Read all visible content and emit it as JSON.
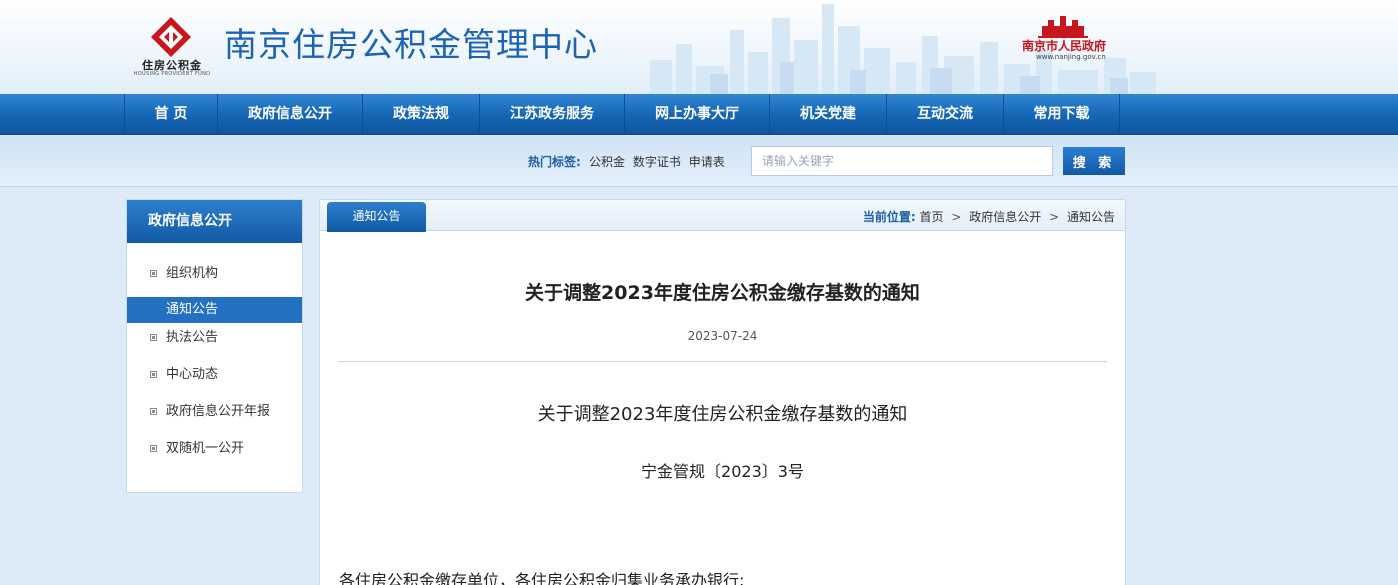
{
  "header": {
    "logo_text": "住房公积金",
    "logo_subtext": "HOUSING PROVIDENT FUND",
    "site_title": "南京住房公积金管理中心",
    "gov_name": "南京市人民政府",
    "gov_url": "www.nanjing.gov.cn"
  },
  "nav": {
    "items": [
      {
        "label": "首 页"
      },
      {
        "label": "政府信息公开"
      },
      {
        "label": "政策法规"
      },
      {
        "label": "江苏政务服务"
      },
      {
        "label": "网上办事大厅"
      },
      {
        "label": "机关党建"
      },
      {
        "label": "互动交流"
      },
      {
        "label": "常用下载"
      }
    ]
  },
  "search": {
    "hot_label": "热门标签:",
    "tags": [
      "公积金",
      "数字证书",
      "申请表"
    ],
    "placeholder": "请输入关键字",
    "button_label": "搜 索"
  },
  "sidebar": {
    "title": "政府信息公开",
    "items": [
      {
        "label": "组织机构",
        "active": false
      },
      {
        "label": "通知公告",
        "active": true
      },
      {
        "label": "执法公告",
        "active": false
      },
      {
        "label": "中心动态",
        "active": false
      },
      {
        "label": "政府信息公开年报",
        "active": false
      },
      {
        "label": "双随机一公开",
        "active": false
      }
    ]
  },
  "panel": {
    "tab_label": "通知公告",
    "breadcrumb": {
      "label": "当前位置:",
      "items": [
        "首页",
        "政府信息公开",
        "通知公告"
      ],
      "separator": ">"
    }
  },
  "article": {
    "title": "关于调整2023年度住房公积金缴存基数的通知",
    "date": "2023-07-24",
    "doc_title": "关于调整2023年度住房公积金缴存基数的通知",
    "doc_number": "宁金管规〔2023〕3号",
    "greeting": "各住房公积金缴存单位，各住房公积金归集业务承办银行:"
  },
  "colors": {
    "brand_blue": "#1a63b5",
    "nav_blue": "#1565b4",
    "logo_red": "#c8161d",
    "active_item": "#2470c2"
  }
}
